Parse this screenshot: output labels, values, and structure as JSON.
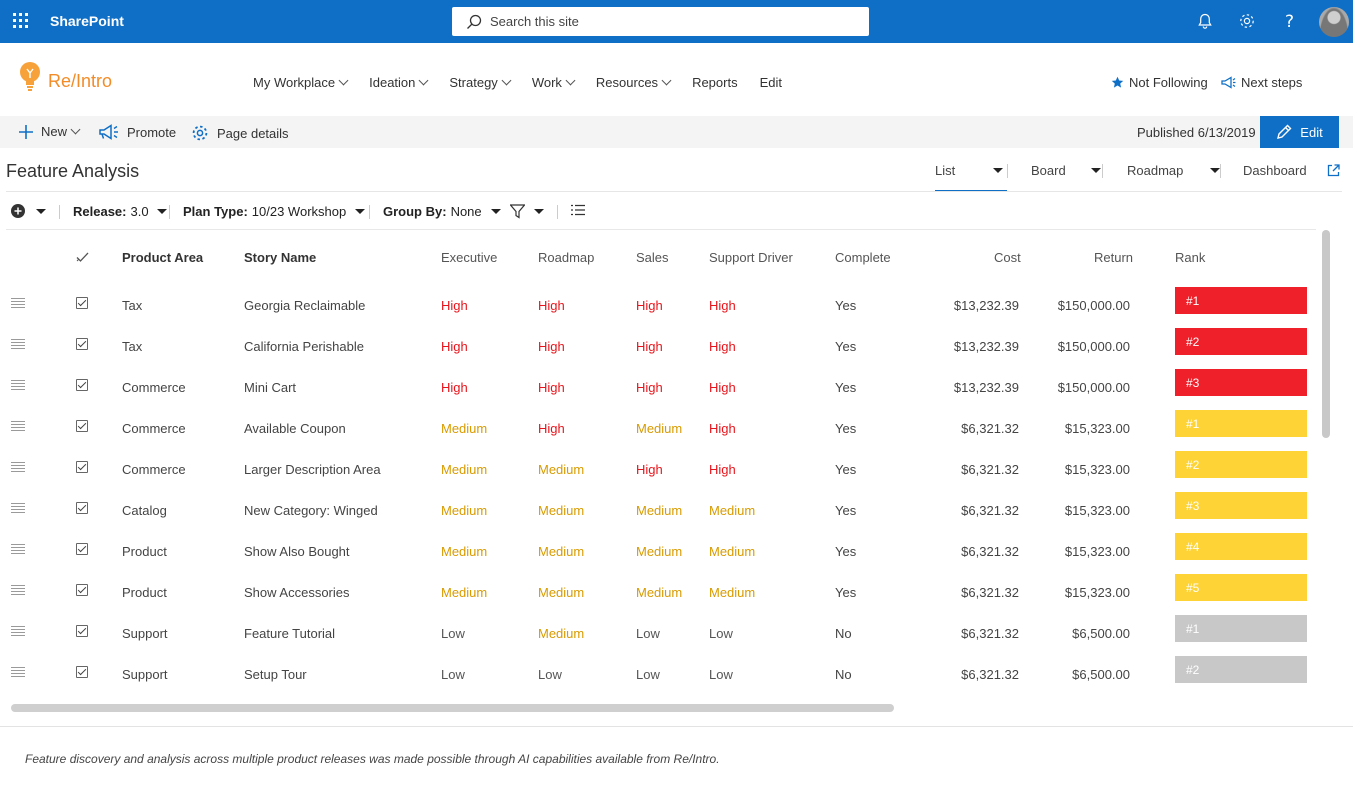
{
  "suite": {
    "app_name": "SharePoint",
    "search_placeholder": "Search this site"
  },
  "site": {
    "name": "Re/Intro",
    "nav": [
      {
        "label": "My Workplace",
        "has_dropdown": true
      },
      {
        "label": "Ideation",
        "has_dropdown": true
      },
      {
        "label": "Strategy",
        "has_dropdown": true
      },
      {
        "label": "Work",
        "has_dropdown": true
      },
      {
        "label": "Resources",
        "has_dropdown": true
      },
      {
        "label": "Reports",
        "has_dropdown": false
      },
      {
        "label": "Edit",
        "has_dropdown": false
      }
    ],
    "follow_label": "Not Following",
    "next_steps_label": "Next steps"
  },
  "command_bar": {
    "new_label": "New",
    "promote_label": "Promote",
    "page_details_label": "Page details",
    "published": "Published 6/13/2019",
    "edit_label": "Edit"
  },
  "page": {
    "title": "Feature Analysis",
    "views": [
      "List",
      "Board",
      "Roadmap",
      "Dashboard"
    ],
    "active_view": "List"
  },
  "filters": {
    "release_label": "Release:",
    "release_value": "3.0",
    "plan_type_label": "Plan Type:",
    "plan_type_value": "10/23 Workshop",
    "group_by_label": "Group By:",
    "group_by_value": "None"
  },
  "table": {
    "headers": {
      "product_area": "Product Area",
      "story_name": "Story Name",
      "executive": "Executive",
      "roadmap": "Roadmap",
      "sales": "Sales",
      "support_driver": "Support Driver",
      "complete": "Complete",
      "cost": "Cost",
      "return": "Return",
      "rank": "Rank"
    },
    "rows": [
      {
        "area": "Tax",
        "story": "Georgia Reclaimable",
        "executive": "High",
        "roadmap": "High",
        "sales": "High",
        "support": "High",
        "complete": "Yes",
        "cost": "$13,232.39",
        "return": "$150,000.00",
        "rank": "#1",
        "rank_color": "#f0202a"
      },
      {
        "area": "Tax",
        "story": "California Perishable",
        "executive": "High",
        "roadmap": "High",
        "sales": "High",
        "support": "High",
        "complete": "Yes",
        "cost": "$13,232.39",
        "return": "$150,000.00",
        "rank": "#2",
        "rank_color": "#f0202a"
      },
      {
        "area": "Commerce",
        "story": "Mini Cart",
        "executive": "High",
        "roadmap": "High",
        "sales": "High",
        "support": "High",
        "complete": "Yes",
        "cost": "$13,232.39",
        "return": "$150,000.00",
        "rank": "#3",
        "rank_color": "#f0202a"
      },
      {
        "area": "Commerce",
        "story": "Available Coupon",
        "executive": "Medium",
        "roadmap": "High",
        "sales": "Medium",
        "support": "High",
        "complete": "Yes",
        "cost": "$6,321.32",
        "return": "$15,323.00",
        "rank": "#1",
        "rank_color": "#fdd335"
      },
      {
        "area": "Commerce",
        "story": "Larger Description Area",
        "executive": "Medium",
        "roadmap": "Medium",
        "sales": "High",
        "support": "High",
        "complete": "Yes",
        "cost": "$6,321.32",
        "return": "$15,323.00",
        "rank": "#2",
        "rank_color": "#fdd335"
      },
      {
        "area": "Catalog",
        "story": "New Category: Winged",
        "executive": "Medium",
        "roadmap": "Medium",
        "sales": "Medium",
        "support": "Medium",
        "complete": "Yes",
        "cost": "$6,321.32",
        "return": "$15,323.00",
        "rank": "#3",
        "rank_color": "#fdd335"
      },
      {
        "area": "Product",
        "story": "Show Also Bought",
        "executive": "Medium",
        "roadmap": "Medium",
        "sales": "Medium",
        "support": "Medium",
        "complete": "Yes",
        "cost": "$6,321.32",
        "return": "$15,323.00",
        "rank": "#4",
        "rank_color": "#fdd335"
      },
      {
        "area": "Product",
        "story": "Show Accessories",
        "executive": "Medium",
        "roadmap": "Medium",
        "sales": "Medium",
        "support": "Medium",
        "complete": "Yes",
        "cost": "$6,321.32",
        "return": "$15,323.00",
        "rank": "#5",
        "rank_color": "#fdd335"
      },
      {
        "area": "Support",
        "story": "Feature Tutorial",
        "executive": "Low",
        "roadmap": "Medium",
        "sales": "Low",
        "support": "Low",
        "complete": "No",
        "cost": "$6,321.32",
        "return": "$6,500.00",
        "rank": "#1",
        "rank_color": "#c8c8c8"
      },
      {
        "area": "Support",
        "story": "Setup Tour",
        "executive": "Low",
        "roadmap": "Low",
        "sales": "Low",
        "support": "Low",
        "complete": "No",
        "cost": "$6,321.32",
        "return": "$6,500.00",
        "rank": "#2",
        "rank_color": "#c8c8c8"
      }
    ]
  },
  "level_colors": {
    "High": "#e8141b",
    "Medium": "#d89b00",
    "Low": "#555555"
  },
  "colors": {
    "brand": "#0f6fc6",
    "accent": "#f28c28"
  },
  "icons": [
    "waffle-icon",
    "search-icon",
    "bell-icon",
    "gear-icon",
    "help-icon",
    "lightbulb-logo-icon",
    "star-icon",
    "megaphone-icon",
    "plus-icon",
    "settings-icon",
    "pencil-icon",
    "external-link-icon",
    "add-circle-icon",
    "filter-icon",
    "list-icon",
    "drag-handle-icon",
    "checkbox-icon"
  ],
  "footer": {
    "note": "Feature discovery and analysis across multiple product releases was made possible through AI capabilities available from Re/Intro."
  }
}
